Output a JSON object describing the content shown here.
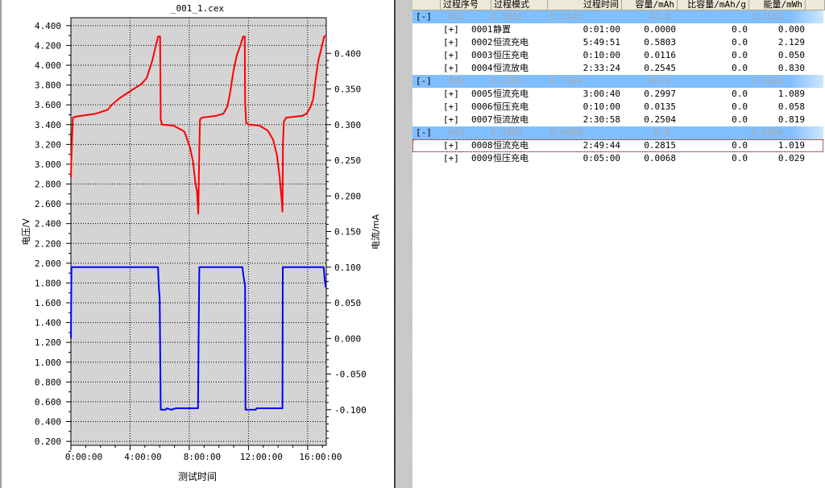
{
  "chart_data": {
    "type": "line",
    "title": "_001_1.cex",
    "xlabel": "测试时间",
    "ylabel_left": "电压/V",
    "ylabel_right": "电流/mA",
    "x_unit": "hours",
    "x_ticks": [
      "0:00:00",
      "4:00:00",
      "8:00:00",
      "12:00:00",
      "16:00:00"
    ],
    "x_tick_values": [
      0,
      4,
      8,
      12,
      16
    ],
    "xlim": [
      0,
      17.26
    ],
    "y_left_ticks": [
      "4.400",
      "4.200",
      "4.000",
      "3.800",
      "3.600",
      "3.400",
      "3.200",
      "3.000",
      "2.800",
      "2.600",
      "2.400",
      "2.200",
      "2.000",
      "1.800",
      "1.600",
      "1.400",
      "1.200",
      "1.000",
      "0.800",
      "0.600",
      "0.400",
      "0.200"
    ],
    "y_left_lim": [
      0.16,
      4.48
    ],
    "y_right_ticks": [
      "0.400",
      "0.350",
      "0.300",
      "0.250",
      "0.200",
      "0.150",
      "0.100",
      "0.050",
      "0.000",
      "-0.050",
      "-0.100"
    ],
    "y_right_lim": [
      -0.15,
      0.45
    ],
    "grid": true,
    "plot_background": "#d4d4d4",
    "series": [
      {
        "axis": "left",
        "color": "#ff0000",
        "x": [
          0,
          0.03,
          0.13,
          0.3,
          1.67,
          2.49,
          2.76,
          3.31,
          4.03,
          4.76,
          5.12,
          5.49,
          5.76,
          5.89,
          6.03,
          6.07,
          6.16,
          6.94,
          7.67,
          8.03,
          8.25,
          8.43,
          8.52,
          8.61,
          8.67,
          8.72,
          8.85,
          9.85,
          10.3,
          10.57,
          10.75,
          10.97,
          11.21,
          11.48,
          11.63,
          11.75,
          11.77,
          11.84,
          12.02,
          12.75,
          13.3,
          13.66,
          13.93,
          14.11,
          14.24,
          14.3,
          14.33,
          14.39,
          14.54,
          15.66,
          15.93,
          16.2,
          16.38,
          16.53,
          16.71,
          16.93,
          17.12,
          17.26
        ],
        "y": [
          2.87,
          3.06,
          3.47,
          3.48,
          3.51,
          3.55,
          3.6,
          3.67,
          3.74,
          3.81,
          3.87,
          4.04,
          4.21,
          4.29,
          4.29,
          3.45,
          3.4,
          3.39,
          3.33,
          3.18,
          3.03,
          2.79,
          2.73,
          2.5,
          3.06,
          3.45,
          3.47,
          3.49,
          3.51,
          3.58,
          3.71,
          3.93,
          4.1,
          4.21,
          4.29,
          4.29,
          3.63,
          3.42,
          3.4,
          3.39,
          3.34,
          3.25,
          3.09,
          2.87,
          2.65,
          2.52,
          3.2,
          3.43,
          3.47,
          3.49,
          3.51,
          3.58,
          3.66,
          3.85,
          4.04,
          4.17,
          4.29,
          4.3
        ]
      },
      {
        "axis": "right",
        "color": "#0000ff",
        "x": [
          0,
          0.04,
          5.89,
          5.94,
          6.0,
          6.07,
          6.4,
          6.5,
          6.76,
          7.1,
          8.59,
          8.63,
          8.68,
          11.59,
          11.65,
          11.77,
          11.8,
          12.49,
          12.55,
          14.3,
          14.32,
          17.08,
          17.17,
          17.24
        ],
        "y": [
          0.0,
          0.1,
          0.1,
          0.072,
          0.057,
          -0.1,
          -0.1,
          -0.098,
          -0.1,
          -0.098,
          -0.098,
          0.0,
          0.1,
          0.1,
          0.089,
          0.074,
          -0.1,
          -0.1,
          -0.098,
          -0.098,
          0.1,
          0.1,
          0.08,
          0.071
        ]
      }
    ]
  },
  "table": {
    "columns": [
      "",
      "过程序号",
      "过程模式",
      "过程时间",
      "容量/mAh",
      "比容量/mAh/g",
      "能量/mWh"
    ],
    "groups": [
      {
        "toggle": "[-]",
        "values": [
          "001",
          "0.5919",
          "0.2545",
          "43.0",
          "3.3583"
        ],
        "rows": [
          {
            "toggle": "[+]",
            "id": "0001",
            "mode": "静置",
            "time": "0:01:00",
            "cap": "0.0000",
            "spec": "0.0",
            "energy": "0.000"
          },
          {
            "toggle": "[+]",
            "id": "0002",
            "mode": "恒流充电",
            "time": "5:49:51",
            "cap": "0.5803",
            "spec": "0.0",
            "energy": "2.129"
          },
          {
            "toggle": "[+]",
            "id": "0003",
            "mode": "恒压充电",
            "time": "0:10:00",
            "cap": "0.0116",
            "spec": "0.0",
            "energy": "0.050"
          },
          {
            "toggle": "[+]",
            "id": "0004",
            "mode": "恒流放电",
            "time": "2:33:24",
            "cap": "0.2545",
            "spec": "0.0",
            "energy": "0.830"
          }
        ]
      },
      {
        "toggle": "[-]",
        "values": [
          "002",
          "0.3132",
          "0.2504",
          "80.0",
          "3.3628"
        ],
        "rows": [
          {
            "toggle": "[+]",
            "id": "0005",
            "mode": "恒流充电",
            "time": "3:00:40",
            "cap": "0.2997",
            "spec": "0.0",
            "energy": "1.089"
          },
          {
            "toggle": "[+]",
            "id": "0006",
            "mode": "恒压充电",
            "time": "0:10:00",
            "cap": "0.0135",
            "spec": "0.0",
            "energy": "0.058"
          },
          {
            "toggle": "[+]",
            "id": "0007",
            "mode": "恒流放电",
            "time": "2:30:58",
            "cap": "0.2504",
            "spec": "0.0",
            "energy": "0.819"
          }
        ]
      },
      {
        "toggle": "[-]",
        "values": [
          "003",
          "0.2883",
          "0.0000",
          "0.0",
          "0.0000"
        ],
        "rows": [
          {
            "toggle": "[+]",
            "id": "0008",
            "mode": "恒流充电",
            "time": "2:49:44",
            "cap": "0.2815",
            "spec": "0.0",
            "energy": "1.019",
            "selected": true
          },
          {
            "toggle": "[+]",
            "id": "0009",
            "mode": "恒压充电",
            "time": "0:05:00",
            "cap": "0.0068",
            "spec": "0.0",
            "energy": "0.029"
          }
        ]
      }
    ]
  }
}
